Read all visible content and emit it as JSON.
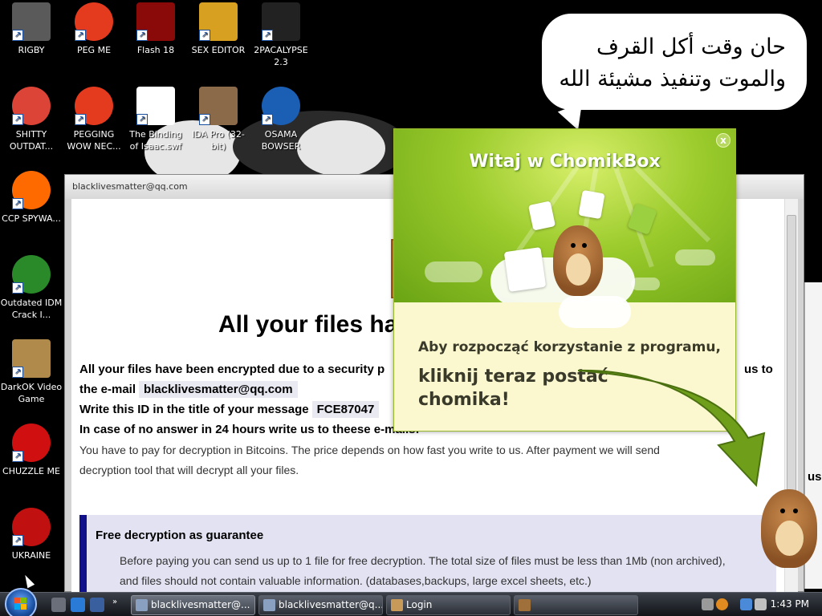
{
  "desktop": {
    "icons": [
      {
        "label": "RIGBY",
        "icon": "raccoon-icon",
        "color": "#5a5a5a"
      },
      {
        "label": "PEG ME",
        "icon": "peggle-icon",
        "color": "#e43a1e"
      },
      {
        "label": "Flash 18",
        "icon": "flash-icon",
        "color": "#8a0a0a"
      },
      {
        "label": "SEX EDITOR",
        "icon": "hxd-icon",
        "color": "#d8a020"
      },
      {
        "label": "2PACALYPSE 2.3",
        "icon": "terminal-icon",
        "color": "#222222"
      },
      {
        "label": "SHITTY OUTDAT...",
        "icon": "chrome-icon",
        "color": "#db4437"
      },
      {
        "label": "PEGGING WOW NEC...",
        "icon": "peggle-icon",
        "color": "#e43a1e"
      },
      {
        "label": "The Binding of Isaac.swf",
        "icon": "flash-file-icon",
        "color": "#ffffff"
      },
      {
        "label": "IDA Pro (32-bit)",
        "icon": "ida-portrait-icon",
        "color": "#8b6a4a"
      },
      {
        "label": "OSAMA BOWSER",
        "icon": "obama-logo-icon",
        "color": "#1a5fb4"
      },
      {
        "label": "CCP SPYWA...",
        "icon": "pinwheel-icon",
        "color": "#ff6a00"
      },
      {
        "label": "Outdated IDM Crack I...",
        "icon": "idm-globe-icon",
        "color": "#2a8a2a"
      },
      {
        "label": "DarkOK Video Game",
        "icon": "money-bag-icon",
        "color": "#b08a4a"
      },
      {
        "label": "CHUZZLE ME",
        "icon": "chuzzle-icon",
        "color": "#d01010"
      },
      {
        "label": "UKRAINE",
        "icon": "radiation-icon",
        "color": "#c01010"
      }
    ]
  },
  "bubble": {
    "line1": "حان وقت أكل القرف",
    "line2": "والموت وتنفيذ مشيئة الله"
  },
  "ransom": {
    "title": "blacklivesmatter@qq.com",
    "headline": "All your files ha",
    "line1": "All your files have been encrypted due to a security p",
    "line1_right": "us to",
    "line2_prefix": "the e-mail",
    "email": "blacklivesmatter@qq.com",
    "line3_prefix": "Write this ID in the title of your message",
    "id_value": "FCE87047",
    "line4": "In case of no answer in 24 hours write us to theese e-mails:",
    "pay1": "You have to pay for decryption in Bitcoins. The price depends on how fast you write to us. After payment we will send",
    "pay2": "decryption tool that will decrypt all your files.",
    "guarantee_title": "Free decryption as guarantee",
    "guarantee_p1": "Before paying you can send us up to 1 file for free decryption. The total size of files must be less than 1Mb (non archived),",
    "guarantee_p2": "and files should not contain valuable information. (databases,backups, large excel sheets, etc.)",
    "side_fragment": "us",
    "side_fragment2": "e"
  },
  "chomikbox": {
    "title": "Witaj w ChomikBox",
    "close_label": "x",
    "msg1": "Aby rozpocząć korzystanie z programu,",
    "msg2": "kliknij teraz postać chomika!",
    "accent": "#8fbf1e"
  },
  "taskbar": {
    "buttons": [
      {
        "label": "blacklivesmatter@...",
        "active": true
      },
      {
        "label": "blacklivesmatter@q...",
        "active": false
      },
      {
        "label": "Login",
        "active": false
      },
      {
        "label": "",
        "active": false
      }
    ],
    "clock": "1:43 PM"
  }
}
